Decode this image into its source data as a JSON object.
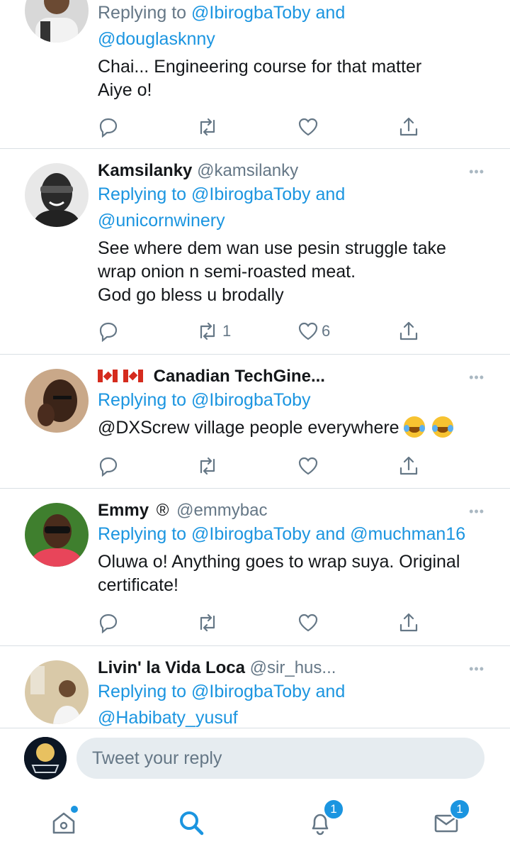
{
  "tweets": [
    {
      "name": "",
      "handle": "",
      "reply_prefix": "Replying to",
      "reply_line1": "@IbirogbaToby and",
      "reply_line2": "@douglasknny",
      "body_lines": [
        "Chai... Engineering course for that matter",
        "Aiye o!"
      ],
      "retweets": "",
      "likes": ""
    },
    {
      "name": "Kamsilanky",
      "handle": "@kamsilanky",
      "reply_prefix": "Replying to",
      "reply_line1": "@IbirogbaToby and",
      "reply_line2": "@unicornwinery",
      "body_lines": [
        "See where dem wan use pesin struggle take",
        "wrap onion n semi-roasted meat.",
        "God go bless u brodally"
      ],
      "retweets": "1",
      "likes": "6"
    },
    {
      "name": "Canadian TechGine...",
      "handle": "",
      "reply_prefix": "Replying to",
      "reply_line1": "@IbirogbaToby",
      "body_mention": "@DXScrew",
      "body_text": " village people everywhere",
      "retweets": "",
      "likes": ""
    },
    {
      "name": "Emmy",
      "name_symbol": "®",
      "handle": "@emmybac",
      "reply_prefix": "Replying to",
      "reply_line1": "@IbirogbaToby and @muchman16",
      "body_lines": [
        "Oluwa o! Anything goes to wrap suya. Original",
        "certificate!"
      ],
      "retweets": "",
      "likes": ""
    },
    {
      "name": "Livin' la Vida Loca",
      "handle": "@sir_hus...",
      "reply_prefix": "Replying to",
      "reply_line1": "@IbirogbaToby and",
      "reply_line2": "@Habibaty_yusuf"
    }
  ],
  "more_label": "•••",
  "composer": {
    "placeholder": "Tweet your reply"
  },
  "tabbar": {
    "notifications_badge": "1",
    "messages_badge": "1"
  },
  "colors": {
    "accent": "#1b95e0",
    "muted": "#657786",
    "divider": "#d9dfe4"
  }
}
